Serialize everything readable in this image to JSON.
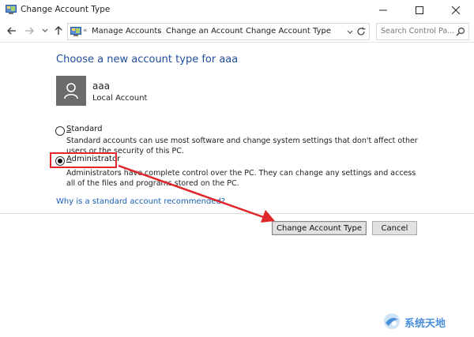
{
  "window": {
    "title": "Change Account Type"
  },
  "nav": {
    "breadcrumbs": [
      "Manage Accounts",
      "Change an Account",
      "Change Account Type"
    ],
    "search_placeholder": "Search Control Pa..."
  },
  "main": {
    "heading": "Choose a new account type for aaa",
    "account": {
      "name": "aaa",
      "type": "Local Account"
    },
    "options": [
      {
        "label_key": "S",
        "label_rest": "tandard",
        "description": "Standard accounts can use most software and change system settings that don't affect other users or the security of this PC.",
        "selected": false
      },
      {
        "label_key": "A",
        "label_rest": "dministrator",
        "description": "Administrators have complete control over the PC. They can change any settings and access all of the files and programs stored on the PC.",
        "selected": true
      }
    ],
    "help_link": "Why is a standard account recommended?"
  },
  "buttons": {
    "change": "Change Account Type",
    "cancel": "Cancel"
  },
  "watermark": {
    "text": "系统天地"
  },
  "colors": {
    "highlight": "#e0262a",
    "heading": "#1f4e9e",
    "link": "#1a5fb4"
  }
}
